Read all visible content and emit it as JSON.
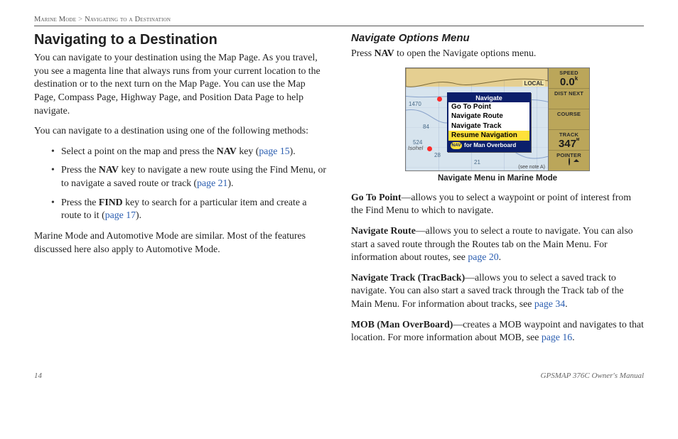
{
  "header": {
    "section": "Marine Mode",
    "sep": ">",
    "subsection": "Navigating to a Destination"
  },
  "left": {
    "title": "Navigating to a Destination",
    "p1": "You can navigate to your destination using the Map Page. As you travel, you see a magenta line that always runs from your current location to the destination or to the next turn on the Map Page. You can use the Map Page, Compass Page, Highway Page, and Position Data Page to help navigate.",
    "p2": "You can navigate to a destination using one of the following methods:",
    "li1a": "Select a point on the map and press the ",
    "li1b": "NAV",
    "li1c": " key (",
    "li1link": "page 15",
    "li1d": ").",
    "li2a": "Press the ",
    "li2b": "NAV",
    "li2c": " key to navigate a new route using the Find Menu, or to navigate a saved route or track (",
    "li2link": "page 21",
    "li2d": ").",
    "li3a": "Press the ",
    "li3b": "FIND",
    "li3c": " key to search for a particular item and create a route to it (",
    "li3link": "page 17",
    "li3d": ").",
    "p3": "Marine Mode and Automotive Mode are similar. Most of the features discussed here also apply to Automotive Mode."
  },
  "right": {
    "subhead": "Navigate Options Menu",
    "intro_a": "Press ",
    "intro_b": "NAV",
    "intro_c": " to open the Navigate options menu.",
    "caption": "Navigate Menu in Marine Mode",
    "gp_title": "Go To Point",
    "gp_body": "—allows you to select a waypoint or point of interest from the Find Menu to which to navigate.",
    "nr_title": "Navigate Route",
    "nr_body_a": "—allows you to select a route to navigate. You can also start a saved route through the Routes tab on the Main Menu. For information about routes, see ",
    "nr_link": "page 20",
    "nr_body_b": ".",
    "nt_title": "Navigate Track (TracBack)",
    "nt_body_a": "—allows you to select a saved track to navigate. You can also start a saved track through the Track tab of the Main Menu. For information about tracks, see ",
    "nt_link": "page 34",
    "nt_body_b": ".",
    "mob_title": "MOB (Man OverBoard)",
    "mob_body_a": "—creates a MOB waypoint and navigates to that location. For more information about MOB, see ",
    "mob_link": "page 16",
    "mob_body_b": "."
  },
  "gps": {
    "popup_header": "Navigate",
    "item1": "Go To Point",
    "item2": "Navigate Route",
    "item3": "Navigate Track",
    "item4": "Resume Navigation",
    "mob_pill": "NAV",
    "mob_text": "for Man Overboard",
    "local": "LOCAL",
    "note": "(see note A)",
    "iso": "Isohel",
    "depths": [
      "1470",
      "84",
      "524",
      "28",
      "21"
    ],
    "side": {
      "speed_lbl": "SPEED",
      "speed_val": "0.0",
      "speed_unit": "k",
      "dist_lbl": "DIST NEXT",
      "course_lbl": "COURSE",
      "track_lbl": "TRACK",
      "track_val": "347",
      "track_unit": "ᴹ",
      "pointer_lbl": "POINTER"
    }
  },
  "footer": {
    "page": "14",
    "manual": "GPSMAP 376C Owner's Manual"
  }
}
